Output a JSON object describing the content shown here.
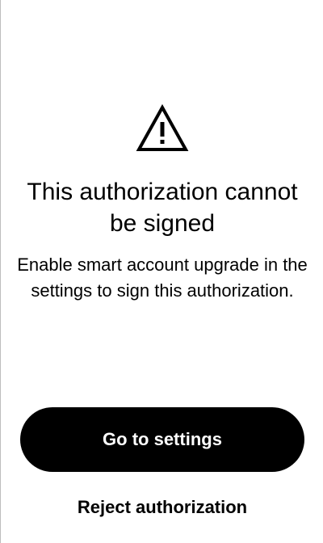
{
  "dialog": {
    "icon": "warning-triangle-icon",
    "title": "This authorization cannot be signed",
    "message": "Enable smart account upgrade in the settings to sign this authorization."
  },
  "actions": {
    "primary_label": "Go to settings",
    "secondary_label": "Reject authorization"
  },
  "colors": {
    "primary_button_bg": "#000000",
    "primary_button_text": "#ffffff",
    "text": "#000000",
    "background": "#ffffff"
  }
}
